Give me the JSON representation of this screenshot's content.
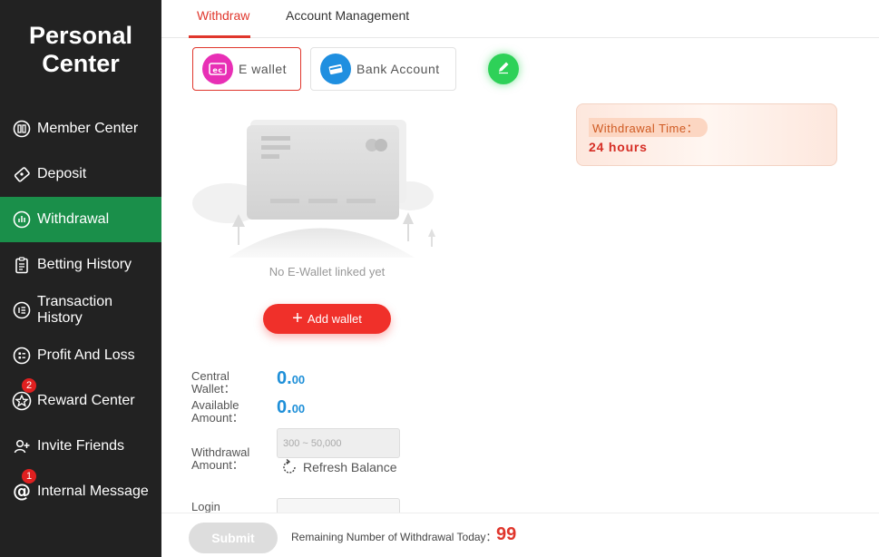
{
  "sidebar": {
    "title": "Personal Center",
    "items": [
      {
        "label": "Member Center",
        "icon": "member-icon",
        "badge": null
      },
      {
        "label": "Deposit",
        "icon": "deposit-icon",
        "badge": null
      },
      {
        "label": "Withdrawal",
        "icon": "withdrawal-icon",
        "badge": null,
        "active": true
      },
      {
        "label": "Betting History",
        "icon": "clipboard-icon",
        "badge": null
      },
      {
        "label": "Transaction History",
        "icon": "list-icon",
        "badge": null
      },
      {
        "label": "Profit And Loss",
        "icon": "profit-icon",
        "badge": null
      },
      {
        "label": "Reward Center",
        "icon": "star-icon",
        "badge": "2"
      },
      {
        "label": "Invite Friends",
        "icon": "invite-icon",
        "badge": null
      },
      {
        "label": "Internal Message",
        "icon": "at-icon",
        "badge": "1"
      }
    ]
  },
  "tabs": [
    {
      "label": "Withdraw",
      "active": true
    },
    {
      "label": "Account Management",
      "active": false
    }
  ],
  "methods": [
    {
      "label": "E wallet",
      "icon": "ewallet-icon",
      "active": true
    },
    {
      "label": "Bank Account",
      "icon": "bank-card-icon",
      "active": false
    }
  ],
  "withdrawal_time": {
    "label": "Withdrawal Time：",
    "value": "24 hours"
  },
  "empty_state": {
    "text": "No E-Wallet linked yet"
  },
  "add_wallet_label": "Add wallet",
  "central_wallet": {
    "label": "Central Wallet：",
    "int": "0.",
    "dec": "00"
  },
  "available_amount": {
    "label": "Available Amount：",
    "int": "0.",
    "dec": "00"
  },
  "withdrawal_amount": {
    "label": "Withdrawal Amount：",
    "placeholder": "300 ~ 50,000"
  },
  "refresh_label": "Refresh Balance",
  "login_label": "Login",
  "footer": {
    "submit_label": "Submit",
    "remaining_label": "Remaining Number of Withdrawal Today：",
    "remaining_count": "99"
  },
  "colors": {
    "accent": "#e0362c",
    "active_nav": "#1a8f4a",
    "amount": "#1e8fd8",
    "edit": "#2ed158"
  }
}
